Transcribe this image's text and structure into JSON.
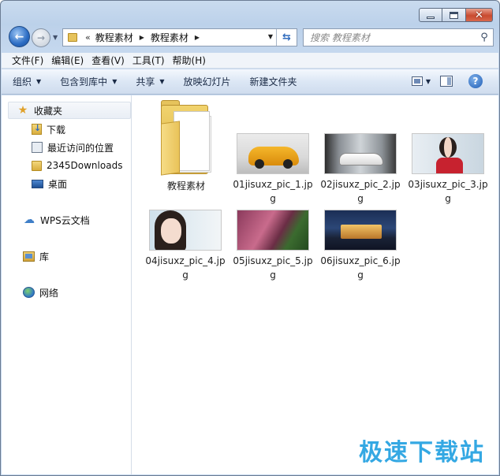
{
  "address": {
    "prefix": "«",
    "crumbs": [
      "教程素材",
      "教程素材"
    ]
  },
  "search": {
    "placeholder": "搜索 教程素材"
  },
  "menu": [
    "文件(F)",
    "编辑(E)",
    "查看(V)",
    "工具(T)",
    "帮助(H)"
  ],
  "commands": {
    "organize": "组织",
    "include_in_library": "包含到库中",
    "share": "共享",
    "slideshow": "放映幻灯片",
    "new_folder": "新建文件夹"
  },
  "navpane": {
    "favorites": "收藏夹",
    "downloads": "下载",
    "recent": "最近访问的位置",
    "downloads2345": "2345Downloads",
    "desktop": "桌面",
    "wps": "WPS云文档",
    "libraries": "库",
    "network": "网络"
  },
  "files": [
    {
      "name": "教程素材",
      "type": "folder"
    },
    {
      "name": "01jisuxz_pic_1.jpg",
      "type": "image",
      "thumb": "yellow-sports-car"
    },
    {
      "name": "02jisuxz_pic_2.jpg",
      "type": "image",
      "thumb": "white-sports-car"
    },
    {
      "name": "03jisuxz_pic_3.jpg",
      "type": "image",
      "thumb": "woman-red-dress"
    },
    {
      "name": "04jisuxz_pic_4.jpg",
      "type": "image",
      "thumb": "woman-portrait"
    },
    {
      "name": "05jisuxz_pic_5.jpg",
      "type": "image",
      "thumb": "aerial-landscape"
    },
    {
      "name": "06jisuxz_pic_6.jpg",
      "type": "image",
      "thumb": "castle-night"
    }
  ],
  "watermark": "极速下载站",
  "colors": {
    "accent": "#2b6cc3",
    "watermark": "#1f9fe0",
    "folder": "#e6c35c"
  }
}
